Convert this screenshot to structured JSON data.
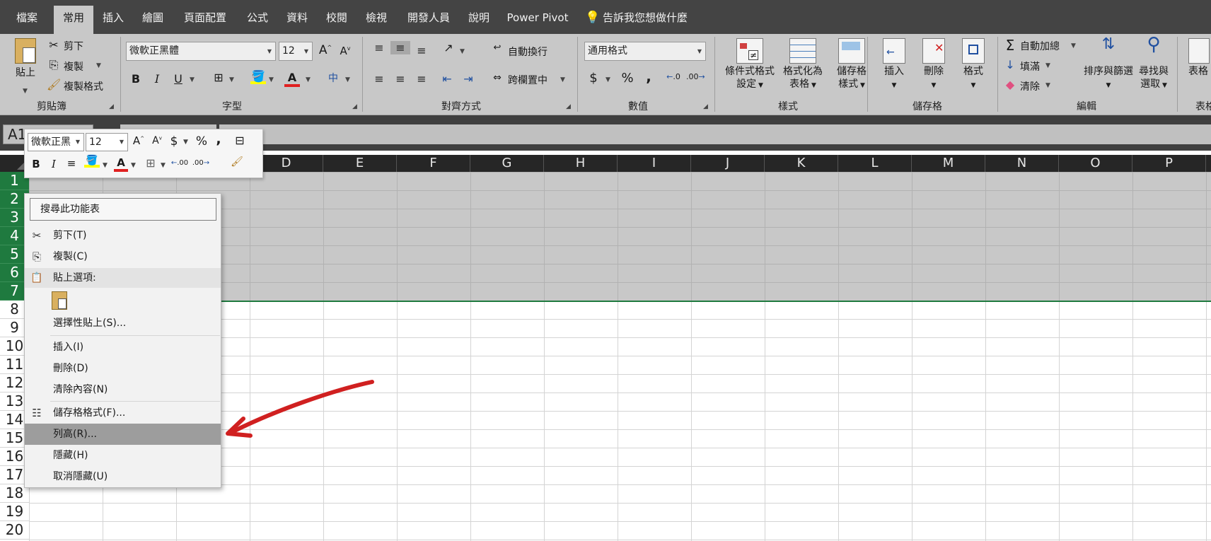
{
  "tabs": [
    {
      "label": "檔案",
      "active": false
    },
    {
      "label": "常用",
      "active": true
    },
    {
      "label": "插入",
      "active": false
    },
    {
      "label": "繪圖",
      "active": false
    },
    {
      "label": "頁面配置",
      "active": false
    },
    {
      "label": "公式",
      "active": false
    },
    {
      "label": "資料",
      "active": false
    },
    {
      "label": "校閱",
      "active": false
    },
    {
      "label": "檢視",
      "active": false
    },
    {
      "label": "開發人員",
      "active": false
    },
    {
      "label": "說明",
      "active": false
    },
    {
      "label": "Power Pivot",
      "active": false
    }
  ],
  "tell_me": "告訴我您想做什麼",
  "ribbon": {
    "clipboard": {
      "paste": "貼上",
      "cut": "剪下",
      "copy": "複製",
      "format_painter": "複製格式",
      "group": "剪貼簿"
    },
    "font": {
      "name": "微軟正黑體",
      "size": "12",
      "group": "字型",
      "bold": "B",
      "italic": "I",
      "underline": "U",
      "grow": "A",
      "shrink": "A",
      "font_color": "A",
      "phonetic": "中"
    },
    "alignment": {
      "wrap": "自動換行",
      "merge": "跨欄置中",
      "group": "對齊方式"
    },
    "number": {
      "format": "通用格式",
      "group": "數值",
      "currency": "$",
      "percent": "%",
      "comma": ",",
      "inc": ".0",
      "dec": ".00"
    },
    "styles": {
      "cond": [
        "條件式格式",
        "設定"
      ],
      "table": [
        "格式化為",
        "表格"
      ],
      "cell": [
        "儲存格",
        "樣式"
      ],
      "group": "樣式"
    },
    "cells": {
      "insert": "插入",
      "delete": "刪除",
      "format": "格式",
      "group": "儲存格"
    },
    "editing": {
      "autosum": "自動加總",
      "fill": "填滿",
      "clear": "清除",
      "sort": [
        "排序與篩選"
      ],
      "find": [
        "尋找與",
        "選取"
      ],
      "group": "編輯"
    },
    "extra": {
      "label": "表格",
      "group": "表格"
    }
  },
  "name_box": "A1",
  "columns": [
    "D",
    "E",
    "F",
    "G",
    "H",
    "I",
    "J",
    "K",
    "L",
    "M",
    "N",
    "O",
    "P"
  ],
  "rows": [
    "1",
    "2",
    "3",
    "4",
    "5",
    "6",
    "7",
    "8",
    "9",
    "10",
    "11",
    "12",
    "13",
    "14",
    "15",
    "16",
    "17",
    "18",
    "19",
    "20"
  ],
  "mini_toolbar": {
    "font": "微軟正黑",
    "size": "12",
    "currency": "$",
    "percent": "%",
    "comma": ",",
    "bold": "B",
    "italic": "I",
    "font_color": "A",
    "inc": ".00",
    "dec": ".00"
  },
  "context_menu": {
    "search": "搜尋此功能表",
    "cut": "剪下(T)",
    "copy": "複製(C)",
    "paste_options": "貼上選項:",
    "paste_special": "選擇性貼上(S)...",
    "insert": "插入(I)",
    "delete": "刪除(D)",
    "clear": "清除內容(N)",
    "format_cells": "儲存格格式(F)...",
    "row_height": "列高(R)...",
    "hide": "隱藏(H)",
    "unhide": "取消隱藏(U)"
  },
  "colors": {
    "accent_green": "#1f7a3f",
    "arrow_red": "#d02020",
    "font_color_red": "#e02020",
    "highlight_yellow": "#ffff00"
  }
}
